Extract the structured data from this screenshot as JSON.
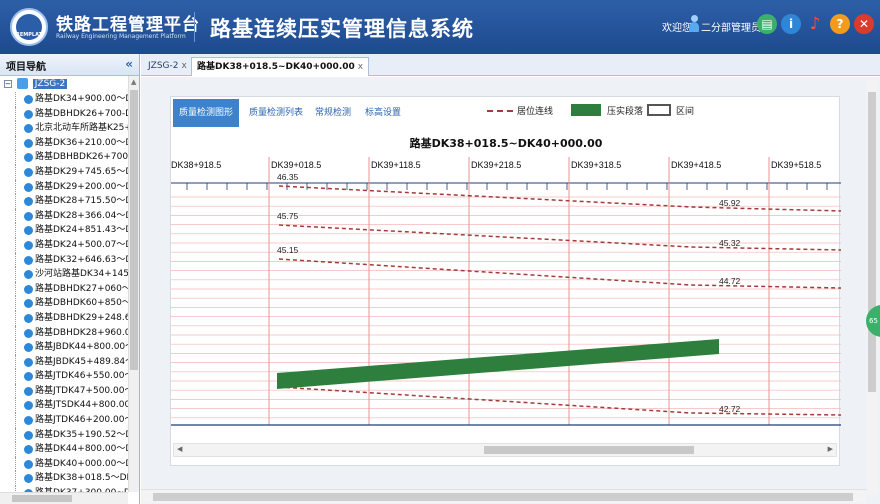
{
  "header": {
    "logo_text": "REMPLAT",
    "brand_cn": "铁路工程管理平台",
    "brand_en": "Railway Engineering Management Platform",
    "system_title": "路基连续压实管理信息系统",
    "welcome": "欢迎您",
    "user": "二分部管理员",
    "buttons": [
      "save-icon",
      "info-icon",
      "bell-icon",
      "help-icon",
      "close-icon"
    ]
  },
  "sidebar": {
    "title": "项目导航",
    "collapse": "«",
    "root": "JZSG-2",
    "items": [
      "路基DK34+900.00～DK34",
      "路基DBHDK26+700-DBH",
      "北京北动车所路基K25+35",
      "路基DK36+210.00～DK32",
      "路基DBHBDK26+700-DBI",
      "路基DK29+745.65～DK30",
      "路基DK29+200.00～DK29",
      "路基DK28+715.50～DK29",
      "路基DK28+366.04～DK28",
      "路基DK24+851.43～DK25",
      "路基DK24+500.07～DK24",
      "路基DK32+646.63～DK33",
      "沙河站路基DK34+145.3",
      "路基DBHDK27+060～DBH",
      "路基DBHDK60+850～DBI",
      "路基DBHDK29+248.61-D",
      "路基DBHDK28+960.00~D",
      "路基JBDK44+800.00～JBD",
      "路基JBDK45+489.84～JBD",
      "路基JTDK46+550.00～JTD",
      "路基JTDK47+500.00～JTD",
      "路基JTSDK44+800.00～JT",
      "路基JTDK46+200.00～JTD",
      "路基DK35+190.52～DK37-",
      "路基DK44+800.00～DK45-",
      "路基DK40+000.00～DK40-",
      "路基DK38+018.5～DK40+",
      "路基DK37+300.00~DK38-"
    ]
  },
  "tabs": [
    {
      "label": "JZSG-2",
      "close": "x"
    },
    {
      "label": "路基DK38+018.5~DK40+000.00",
      "close": "x"
    }
  ],
  "panel": {
    "tabs": [
      "质量检测图形",
      "质量检测列表",
      "常规检测",
      "标高设置"
    ],
    "legend": {
      "position": "居位连线",
      "compacted": "压实段落",
      "interval": "区间"
    },
    "title": "路基DK38+018.5~DK40+000.00"
  },
  "side_badge": "65",
  "colors": {
    "header": "#1e4a8e",
    "accent": "#3c82cd",
    "compacted_segment": "#2e7f3e",
    "position_line": "#a53a3a"
  },
  "chart_data": {
    "type": "line",
    "x_unit": "mileage",
    "x_ticks": [
      "DK38+918.5",
      "DK39+018.5",
      "DK39+118.5",
      "DK39+218.5",
      "DK39+318.5",
      "DK39+418.5",
      "DK39+518.5"
    ],
    "series": [
      {
        "start_label": "46.35",
        "end_label": "45.92"
      },
      {
        "start_label": "45.75",
        "end_label": "45.32"
      },
      {
        "start_label": "45.15",
        "end_label": "44.72"
      },
      {
        "start_label": "",
        "end_label": "42.72"
      }
    ],
    "compacted_segment": {
      "from": "DK39+018.5",
      "to": "DK39+463.5"
    }
  }
}
